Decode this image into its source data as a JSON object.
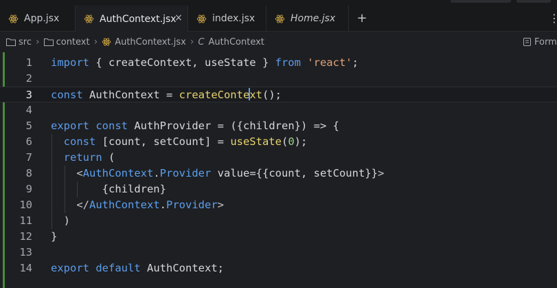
{
  "tabs": [
    {
      "label": "App.jsx",
      "active": false,
      "italic": false,
      "closable": false
    },
    {
      "label": "AuthContext.jsx",
      "active": true,
      "italic": false,
      "closable": true
    },
    {
      "label": "index.jsx",
      "active": false,
      "italic": false,
      "closable": false
    },
    {
      "label": "Home.jsx",
      "active": false,
      "italic": true,
      "closable": false
    }
  ],
  "tab_actions": {
    "add": "+",
    "more": "⋮",
    "close": "×"
  },
  "breadcrumb": {
    "items": [
      "src",
      "context",
      "AuthContext.jsx",
      "AuthContext"
    ],
    "context_symbol": "C",
    "separator": "›"
  },
  "format_label": "Forma",
  "colors": {
    "keyword": "#5c9ded",
    "function": "#e6d46e",
    "string": "#e3a37b",
    "number": "#9dd28c",
    "jsx_tag": "#5aa0f0",
    "modified_gutter": "#4c8a3f",
    "react_icon": "#c9a243"
  },
  "editor": {
    "current_line": 3,
    "lines": [
      {
        "n": "1",
        "tokens": [
          [
            "kw",
            "import"
          ],
          [
            "pln",
            " { createContext, useState } "
          ],
          [
            "kw",
            "from"
          ],
          [
            "pln",
            " "
          ],
          [
            "str",
            "'react'"
          ],
          [
            "pln",
            ";"
          ]
        ]
      },
      {
        "n": "2",
        "tokens": []
      },
      {
        "n": "3",
        "tokens": [
          [
            "kw",
            "const"
          ],
          [
            "pln",
            " AuthContext = "
          ],
          [
            "fn",
            "createConte"
          ],
          [
            "cursor",
            ""
          ],
          [
            "fn",
            "xt"
          ],
          [
            "pln",
            "();"
          ]
        ]
      },
      {
        "n": "4",
        "tokens": []
      },
      {
        "n": "5",
        "tokens": [
          [
            "kw",
            "export"
          ],
          [
            "pln",
            " "
          ],
          [
            "kw",
            "const"
          ],
          [
            "pln",
            " AuthProvider = ({"
          ],
          [
            "param",
            "children"
          ],
          [
            "pln",
            "}) => {"
          ]
        ]
      },
      {
        "n": "6",
        "tokens": [
          [
            "pln",
            "  "
          ],
          [
            "kw",
            "const"
          ],
          [
            "pln",
            " [count, setCount] = "
          ],
          [
            "fn",
            "useState"
          ],
          [
            "pln",
            "("
          ],
          [
            "num",
            "0"
          ],
          [
            "pln",
            ");"
          ]
        ]
      },
      {
        "n": "7",
        "tokens": [
          [
            "pln",
            "  "
          ],
          [
            "kw",
            "return"
          ],
          [
            "pln",
            " ("
          ]
        ]
      },
      {
        "n": "8",
        "tokens": [
          [
            "pln",
            "    "
          ],
          [
            "br",
            "<"
          ],
          [
            "tag",
            "AuthContext"
          ],
          [
            "pln",
            "."
          ],
          [
            "tag",
            "Provider"
          ],
          [
            "pln",
            " value={{count, setCount}}"
          ],
          [
            "br",
            ">"
          ]
        ]
      },
      {
        "n": "9",
        "tokens": [
          [
            "pln",
            "        {children}"
          ]
        ]
      },
      {
        "n": "10",
        "tokens": [
          [
            "pln",
            "    "
          ],
          [
            "br",
            "</"
          ],
          [
            "tag",
            "AuthContext"
          ],
          [
            "pln",
            "."
          ],
          [
            "tag",
            "Provider"
          ],
          [
            "br",
            ">"
          ]
        ]
      },
      {
        "n": "11",
        "tokens": [
          [
            "pln",
            "  )"
          ]
        ]
      },
      {
        "n": "12",
        "tokens": [
          [
            "pln",
            "}"
          ]
        ]
      },
      {
        "n": "13",
        "tokens": []
      },
      {
        "n": "14",
        "tokens": [
          [
            "kw",
            "export"
          ],
          [
            "pln",
            " "
          ],
          [
            "kw",
            "default"
          ],
          [
            "pln",
            " AuthContext;"
          ]
        ]
      }
    ]
  }
}
